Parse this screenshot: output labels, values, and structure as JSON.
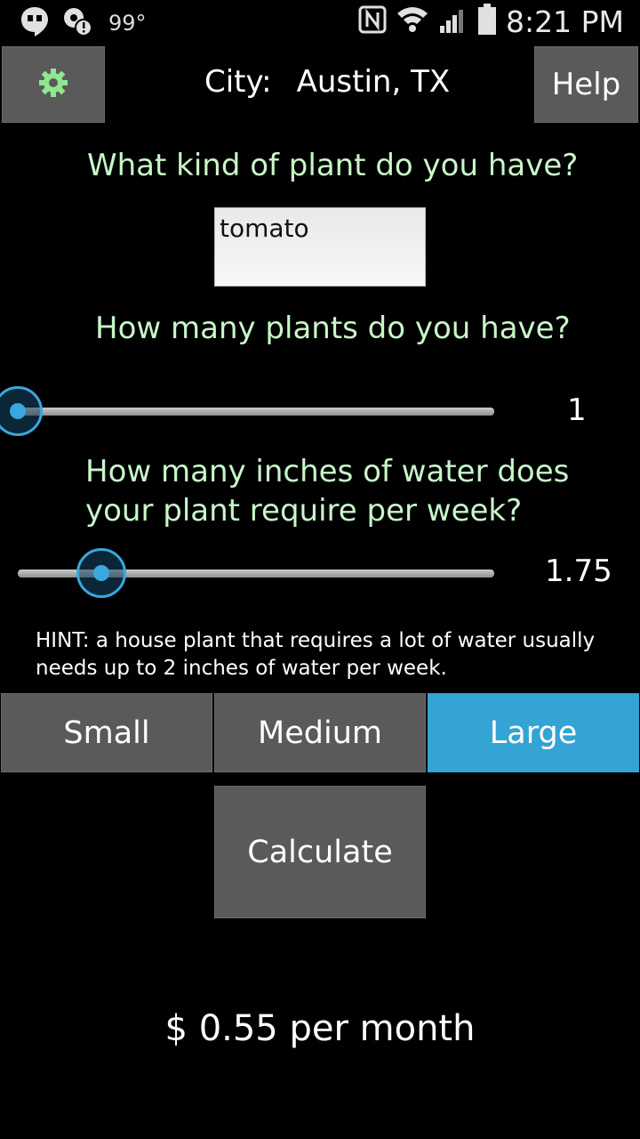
{
  "status_bar": {
    "temperature": "99°",
    "time": "8:21 PM",
    "icons": [
      "hangouts-icon",
      "location-alert-icon",
      "nfc-icon",
      "wifi-icon",
      "signal-icon",
      "battery-icon"
    ]
  },
  "header": {
    "settings_icon": "gear-icon",
    "city_label": "City:",
    "city_value": "Austin, TX",
    "help_label": "Help"
  },
  "plant_type": {
    "question": "What kind of plant do you have?",
    "value": "tomato"
  },
  "plant_count": {
    "question": "How many plants do you have?",
    "value": "1",
    "level": 0.0
  },
  "water_inches": {
    "question_line1": "How many inches of water does",
    "question_line2": "your plant require per week?",
    "value": "1.75",
    "level": 0.175
  },
  "hint": "HINT: a house plant that requires a lot of water usually needs up to 2 inches of water per week.",
  "sizes": {
    "small": "Small",
    "medium": "Medium",
    "large": "Large",
    "selected": "Large"
  },
  "calculate_label": "Calculate",
  "result": "$ 0.55 per month",
  "colors": {
    "accent": "#33a4d4",
    "question_text": "#c8f6c8",
    "button_gray": "#5a5a5a",
    "background": "#000000"
  }
}
